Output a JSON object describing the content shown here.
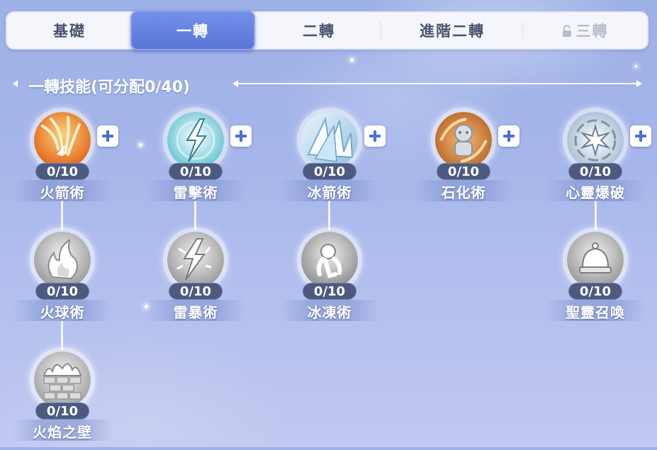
{
  "tabs": [
    {
      "label": "基礎",
      "active": false,
      "locked": false
    },
    {
      "label": "一轉",
      "active": true,
      "locked": false
    },
    {
      "label": "二轉",
      "active": false,
      "locked": false
    },
    {
      "label": "進階二轉",
      "active": false,
      "locked": false
    },
    {
      "label": "三轉",
      "active": false,
      "locked": true
    }
  ],
  "section": {
    "title": "一轉技能(可分配0/40)"
  },
  "skills": {
    "fire_arrow": {
      "name": "火箭術",
      "level": "0/10",
      "icon": "fire-arrow-icon",
      "unlocked": true
    },
    "thunder_bolt": {
      "name": "雷擊術",
      "level": "0/10",
      "icon": "thunder-bolt-icon",
      "unlocked": true
    },
    "ice_arrow": {
      "name": "冰箭術",
      "level": "0/10",
      "icon": "ice-arrow-icon",
      "unlocked": true
    },
    "petrify": {
      "name": "石化術",
      "level": "0/10",
      "icon": "petrify-icon",
      "unlocked": true
    },
    "mind_burst": {
      "name": "心靈爆破",
      "level": "0/10",
      "icon": "mind-burst-icon",
      "unlocked": true
    },
    "fireball": {
      "name": "火球術",
      "level": "0/10",
      "icon": "fireball-icon",
      "unlocked": false
    },
    "thunder_storm": {
      "name": "雷暴術",
      "level": "0/10",
      "icon": "thunder-storm-icon",
      "unlocked": false
    },
    "frost": {
      "name": "冰凍術",
      "level": "0/10",
      "icon": "frost-icon",
      "unlocked": false
    },
    "holy_summon": {
      "name": "聖靈召喚",
      "level": "0/10",
      "icon": "holy-summon-icon",
      "unlocked": false
    },
    "fire_wall": {
      "name": "火焰之壁",
      "level": "0/10",
      "icon": "fire-wall-icon",
      "unlocked": false
    }
  },
  "colors": {
    "accent": "#5a76d8",
    "level_badge": "#4d5a80",
    "fire": "#f08a2a",
    "ice": "#a9d6f0",
    "locked_gray": "#a8a8a8"
  }
}
